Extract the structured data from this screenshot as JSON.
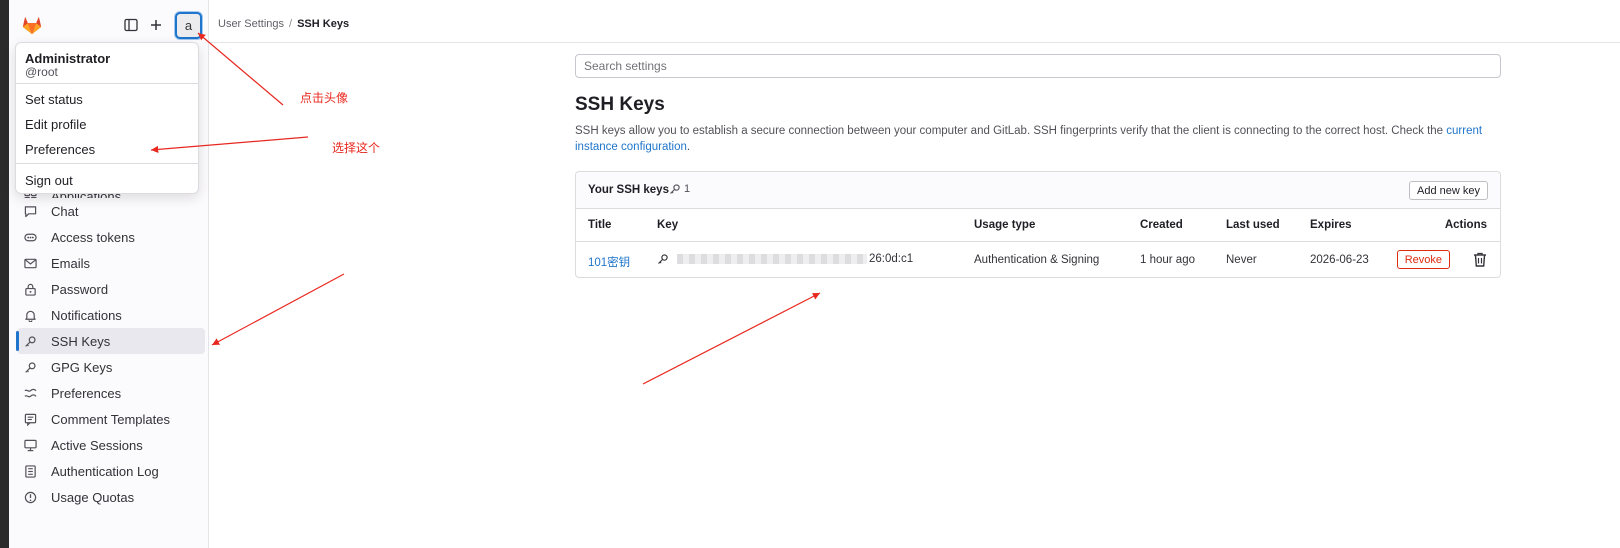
{
  "topbar": {
    "breadcrumb": [
      {
        "label": "User Settings"
      },
      {
        "label": "SSH Keys"
      }
    ]
  },
  "user_menu": {
    "avatar_alt": "a",
    "name": "Administrator",
    "username": "@root",
    "items": [
      {
        "label": "Set status"
      },
      {
        "label": "Edit profile"
      },
      {
        "label": "Preferences"
      }
    ],
    "sign_out": "Sign out"
  },
  "sidebar": {
    "items": [
      {
        "label": "Applications",
        "icon": "applications-icon"
      },
      {
        "label": "Chat",
        "icon": "chat-icon"
      },
      {
        "label": "Access tokens",
        "icon": "token-icon"
      },
      {
        "label": "Emails",
        "icon": "mail-icon"
      },
      {
        "label": "Password",
        "icon": "lock-icon"
      },
      {
        "label": "Notifications",
        "icon": "bell-icon"
      },
      {
        "label": "SSH Keys",
        "icon": "key-icon",
        "active": true
      },
      {
        "label": "GPG Keys",
        "icon": "key-icon"
      },
      {
        "label": "Preferences",
        "icon": "preferences-icon"
      },
      {
        "label": "Comment Templates",
        "icon": "comment-icon"
      },
      {
        "label": "Active Sessions",
        "icon": "monitor-icon"
      },
      {
        "label": "Authentication Log",
        "icon": "log-icon"
      },
      {
        "label": "Usage Quotas",
        "icon": "quota-icon"
      }
    ]
  },
  "search": {
    "placeholder": "Search settings"
  },
  "page": {
    "title": "SSH Keys",
    "description": "SSH keys allow you to establish a secure connection between your computer and GitLab. SSH fingerprints verify that the client is connecting to the correct host. Check the ",
    "description_link": "current instance configuration",
    "description_end": "."
  },
  "keys_card": {
    "title": "Your SSH keys",
    "count": "1",
    "add_button": "Add new key",
    "columns": [
      "Title",
      "Key",
      "Usage type",
      "Created",
      "Last used",
      "Expires",
      "Actions"
    ],
    "rows": [
      {
        "title": "101密钥",
        "key_suffix": "26:0d:c1",
        "usage_type": "Authentication & Signing",
        "created": "1 hour ago",
        "last_used": "Never",
        "expires": "2026-06-23",
        "revoke": "Revoke"
      }
    ]
  },
  "annotations": {
    "click_avatar": "点击头像",
    "choose_this": "选择这个"
  },
  "colors": {
    "accent": "#1f75cb",
    "danger": "#dd2b0e",
    "annotation": "#e8281f",
    "logo": "#e24329"
  }
}
